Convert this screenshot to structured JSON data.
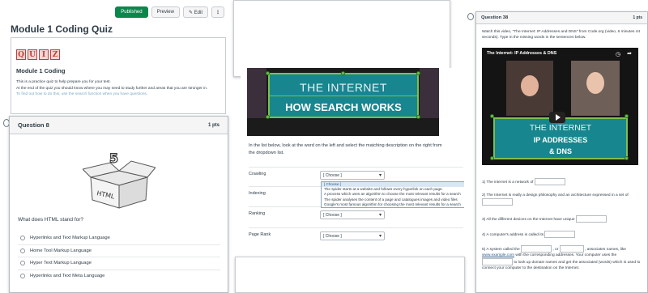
{
  "module": {
    "buttons": {
      "published": "Published",
      "preview": "Preview",
      "edit": "✎ Edit",
      "more": "⋮"
    },
    "title": "Module 1 Coding Quiz",
    "logo_letters": [
      "Q",
      "U",
      "I",
      "Z"
    ],
    "section_title": "Module 1 Coding",
    "line1": "This is a practice quiz to help prepare you for your test.",
    "line2": "At the end of the quiz you should know where you may need to study further and areas that you are stronger in.",
    "line3": "To find out how to do this, use the search function when you have questions."
  },
  "q8": {
    "title": "Question 8",
    "points": "1 pts",
    "box_label_1": "HTML",
    "box_label_2": "5",
    "prompt": "What does HTML stand for?",
    "options": [
      "Hyperlinks and Text Markup Language",
      "Home Tool Markup Language",
      "Hyper Text Markup Language",
      "Hyperlinks and Text Meta Language"
    ]
  },
  "matching": {
    "video_line1": "THE INTERNET",
    "video_line2": "HOW SEARCH WORKS",
    "instructions": "In the list below, look at the word on the left and select the matching description on the right from the dropdown list.",
    "choose": "[ Choose ]",
    "rows": [
      "Crawling",
      "Indexing",
      "Ranking",
      "Page Rank"
    ],
    "dropdown": [
      "[ Choose ]",
      "The spider starts at a website and follows every hyperlink on each page.",
      "A process which uses an algorithm to choose the most relevant results for a search",
      "The spider analyses the content of a page and catalogues images and video files",
      "Google's most famous algorithm for choosing the most relevant results for a search"
    ]
  },
  "q38": {
    "title": "Question 38",
    "points": "1 pts",
    "intro": "Watch this video, \"The Internet: IP Addresses and DNS\" from Code.org (video, 6 minutes 44 seconds). Type in the missing words in the sentences below.",
    "video_title": "The Internet: IP Addresses & DNS",
    "video_line1": "THE INTERNET",
    "video_line2": "IP ADDRESSES",
    "video_line3": "& DNS",
    "s1": "1) The internet is a network of",
    "s2a": "2) The Internet is really a design philosophy and an architecture expressed in a set of",
    "s3": "3) All the different devices on the Internet have unique",
    "s4": "4) A computer's address is called its",
    "s5a": "5) A system called the",
    "s5b": ", or",
    "s5c": ", associates names,",
    "s5d": "like",
    "s5link": "www.example.com",
    "s5e": "with the corresponding addresses. Your computer uses the",
    "s5f": "to look up domain names and get the associated (words) which is",
    "s5g": "used to connect your computer to the destination on the Internet."
  }
}
